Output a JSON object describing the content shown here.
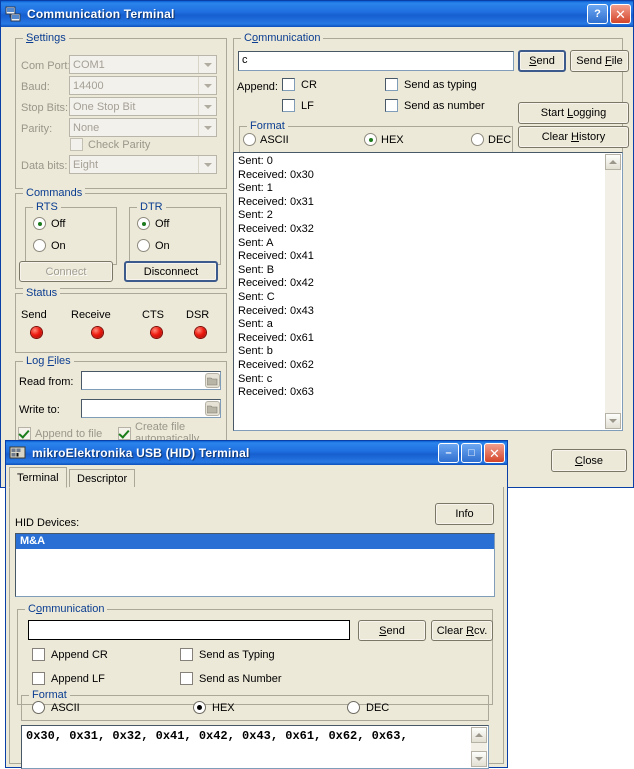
{
  "window_comm": {
    "title": "Communication Terminal",
    "icon": "network-terminal-icon",
    "buttons": {
      "help": "?",
      "close": "✕"
    },
    "settings": {
      "caption": "Settings",
      "fields": [
        {
          "label": "Com Port:",
          "value": "COM1"
        },
        {
          "label": "Baud:",
          "value": "14400"
        },
        {
          "label": "Stop Bits:",
          "value": "One Stop Bit"
        },
        {
          "label": "Parity:",
          "value": "None"
        },
        {
          "label": "Data bits:",
          "value": "Eight"
        }
      ],
      "check_parity": {
        "label": "Check Parity",
        "checked": false,
        "enabled": false
      }
    },
    "commands": {
      "caption": "Commands",
      "rts": {
        "caption": "RTS",
        "options": [
          "Off",
          "On"
        ],
        "selected": "Off"
      },
      "dtr": {
        "caption": "DTR",
        "options": [
          "Off",
          "On"
        ],
        "selected": "Off"
      },
      "connect": "Connect",
      "disconnect": "Disconnect"
    },
    "status": {
      "caption": "Status",
      "items": [
        {
          "label": "Send",
          "led_color": "#ee1b10"
        },
        {
          "label": "Receive",
          "led_color": "#ee1b10"
        },
        {
          "label": "CTS",
          "led_color": "#ee1b10"
        },
        {
          "label": "DSR",
          "led_color": "#ee1b10"
        }
      ]
    },
    "logfiles": {
      "caption": "Log Files",
      "read_from": {
        "label": "Read from:",
        "value": ""
      },
      "write_to": {
        "label": "Write to:",
        "value": ""
      },
      "append_to_file": {
        "label": "Append to file",
        "checked": true
      },
      "create_file_automatically": {
        "label": "Create file automatically",
        "checked": true
      },
      "browse_icon": "folder-browse-icon"
    },
    "communication": {
      "caption": "Communication",
      "input_value": "c",
      "send": "Send",
      "send_file": "Send File",
      "start_logging": "Start Logging",
      "clear_history": "Clear History",
      "append_label": "Append:",
      "checks": [
        {
          "label": "CR",
          "checked": false
        },
        {
          "label": "LF",
          "checked": false
        },
        {
          "label": "Send as typing",
          "checked": false
        },
        {
          "label": "Send as number",
          "checked": false
        }
      ],
      "format": {
        "caption": "Format",
        "options": [
          "ASCII",
          "HEX",
          "DEC"
        ],
        "selected": "HEX"
      },
      "log_lines": [
        "Sent: 0",
        "Received: 0x30",
        "Sent: 1",
        "Received: 0x31",
        "Sent: 2",
        "Received: 0x32",
        "Sent: A",
        "Received: 0x41",
        "Sent: B",
        "Received: 0x42",
        "Sent: C",
        "Received: 0x43",
        "Sent: a",
        "Received: 0x61",
        "Sent: b",
        "Received: 0x62",
        "Sent: c",
        "Received: 0x63"
      ]
    },
    "close_button": "Close"
  },
  "window_hid": {
    "title": "mikroElektronika USB (HID) Terminal",
    "icon": "usb-hid-terminal-icon",
    "buttons": {
      "minimize": "–",
      "maximize": "□",
      "close": "✕"
    },
    "tabs": [
      {
        "label": "Terminal",
        "active": true
      },
      {
        "label": "Descriptor",
        "active": false
      }
    ],
    "hid_devices_label": "HID Devices:",
    "info_button": "Info",
    "device_list": [
      {
        "name": "M&A",
        "selected": true
      }
    ],
    "communication": {
      "caption": "Communication",
      "input_value": "",
      "send": "Send",
      "clear_rcv": "Clear Rcv.",
      "checks": [
        {
          "label": "Append CR",
          "checked": false
        },
        {
          "label": "Append LF",
          "checked": false
        },
        {
          "label": "Send as Typing",
          "checked": false
        },
        {
          "label": "Send as Number",
          "checked": false
        }
      ],
      "format": {
        "caption": "Format",
        "options": [
          "ASCII",
          "HEX",
          "DEC"
        ],
        "selected": "HEX"
      }
    },
    "received_text": "0x30, 0x31, 0x32, 0x41, 0x42, 0x43, 0x61, 0x62, 0x63,"
  },
  "colors": {
    "title_active": "#1f6fe0",
    "face": "#ece9d8",
    "group_caption": "#0b3d91",
    "selection": "#2a6fd4",
    "led_on": "#ee1b10"
  }
}
